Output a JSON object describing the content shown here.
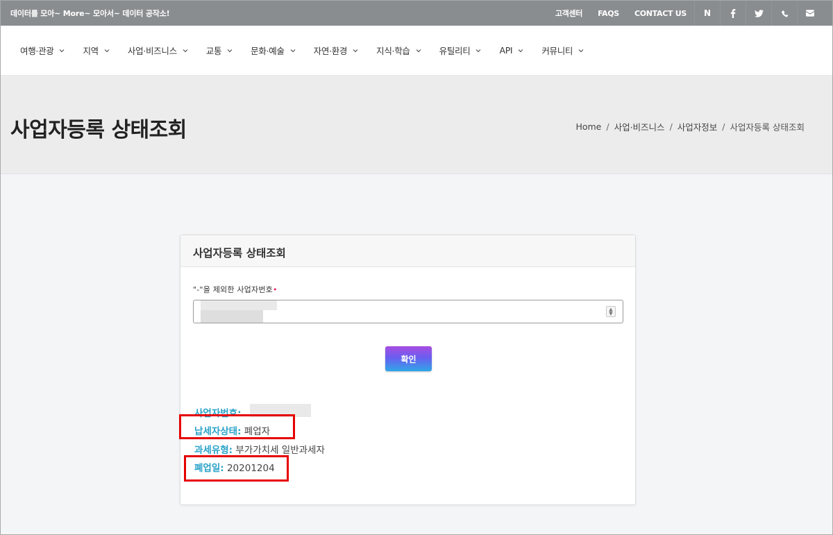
{
  "topbar": {
    "tagline": "데이터를 모아~ More~ 모아서~ 데이터 공작소!",
    "links": [
      "고객센터",
      "FAQS",
      "CONTACT US"
    ],
    "icons": [
      "naver-icon",
      "facebook-icon",
      "twitter-icon",
      "phone-icon",
      "mail-icon"
    ],
    "naver_letter": "N"
  },
  "nav": {
    "items": [
      "여행·관광",
      "지역",
      "사업·비즈니스",
      "교통",
      "문화·예술",
      "자연·환경",
      "지식·학습",
      "유틸리티",
      "API",
      "커뮤니티"
    ]
  },
  "page": {
    "title": "사업자등록 상태조회",
    "breadcrumb": [
      "Home",
      "사업·비즈니스",
      "사업자정보",
      "사업자등록 상태조회"
    ],
    "separator": "/"
  },
  "card": {
    "title": "사업자등록 상태조회",
    "label": "\"-\"을 제외한 사업자번호",
    "required_mark": "•",
    "input_value": "",
    "button_label": "확인",
    "results": {
      "business_number_label": "사업자번호:",
      "business_number_value": "",
      "taxpayer_status_label": "납세자상태:",
      "taxpayer_status_value": "폐업자",
      "tax_type_label": "과세유형:",
      "tax_type_value": "부가가치세 일반과세자",
      "closed_date_label": "폐업일:",
      "closed_date_value": "20201204"
    }
  },
  "colors": {
    "topbar_bg": "#8a8d90",
    "result_key": "#2aa3c8",
    "highlight": "#e50000",
    "required": "#e0245e"
  }
}
